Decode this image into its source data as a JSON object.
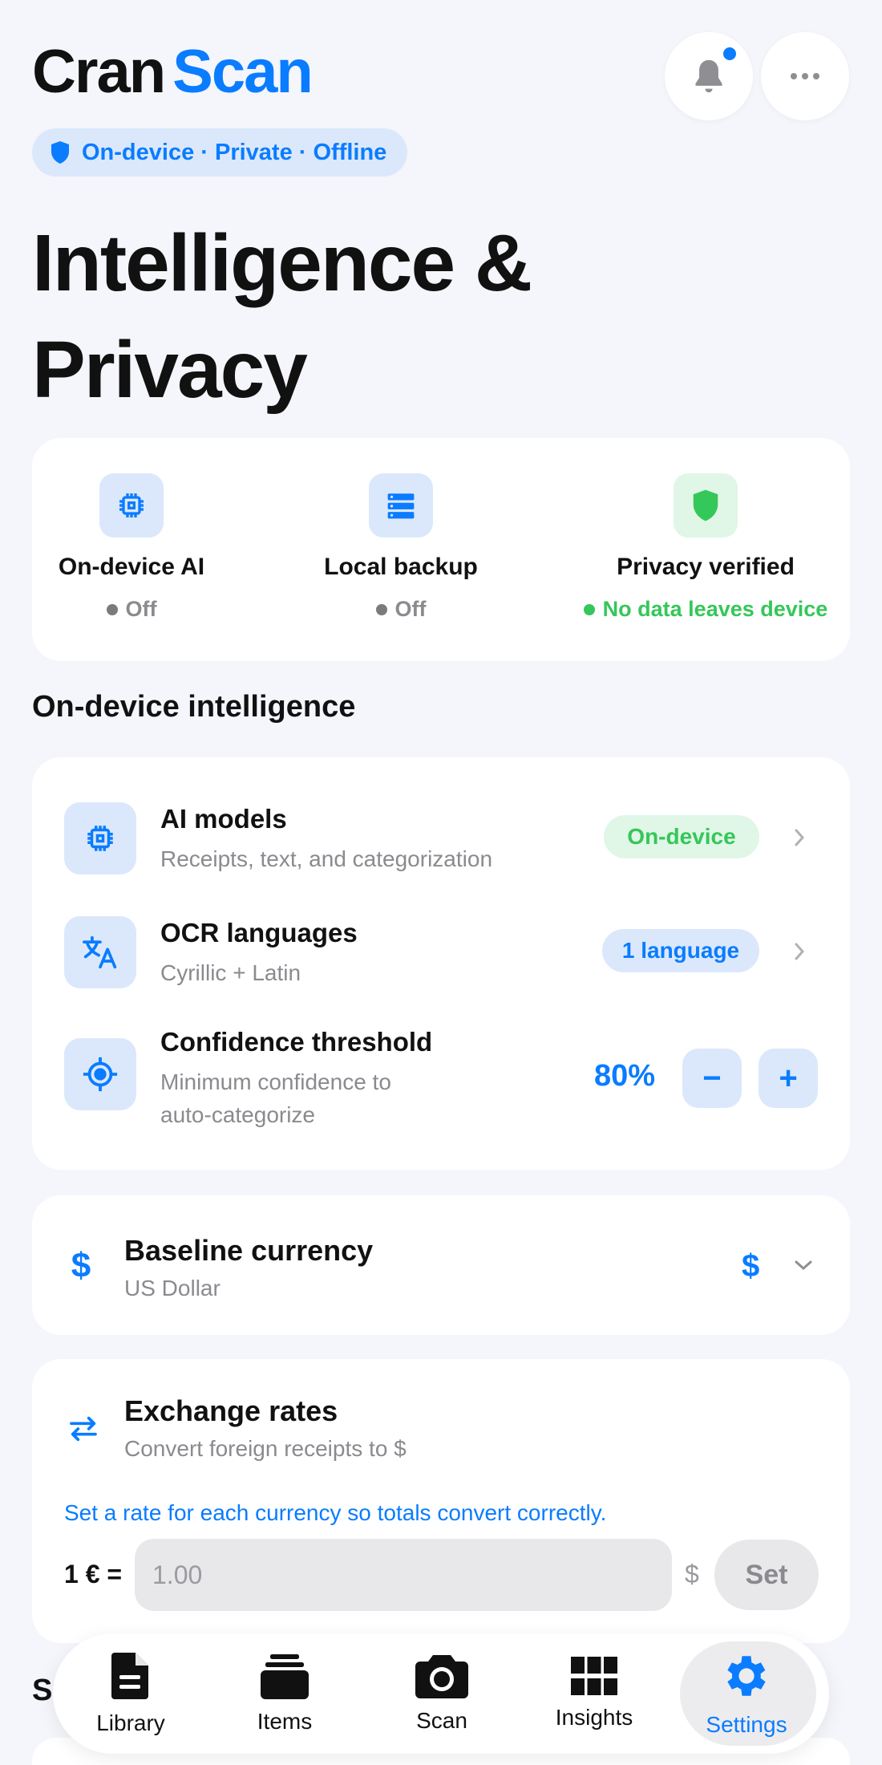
{
  "app": {
    "brand_part1": "Cran",
    "brand_part2": "Scan",
    "privacy_pill": "On-device · Private · Offline"
  },
  "colors": {
    "accent": "#0a7cff",
    "success": "#34c759",
    "background": "#f4f6fb"
  },
  "page": {
    "title": "Intelligence & Privacy"
  },
  "status": [
    {
      "label": "On-device AI",
      "value": "Off",
      "icon": "chip-icon"
    },
    {
      "label": "Local backup",
      "value": "Off",
      "icon": "storage-icon"
    },
    {
      "label": "Privacy verified",
      "value": "No data leaves device",
      "icon": "shield-icon"
    }
  ],
  "intel": {
    "section_title": "On-device intelligence",
    "models": {
      "title": "AI models",
      "subtitle": "Receipts, text, and categorization",
      "badge": "On-device"
    },
    "ocr": {
      "title": "OCR languages",
      "subtitle": "Cyrillic + Latin",
      "badge": "1 language"
    },
    "confidence": {
      "title": "Confidence threshold",
      "subtitle_line1": "Minimum confidence to",
      "subtitle_line2": "auto-categorize",
      "value": "80%",
      "minus": "−",
      "plus": "+"
    }
  },
  "currency": {
    "title": "Baseline currency",
    "subtitle": "US Dollar",
    "symbol": "$"
  },
  "exchange": {
    "title": "Exchange rates",
    "subtitle": "Convert foreign receipts to $",
    "hint": "Set a rate for each currency so totals convert correctly.",
    "rate_label": "1 € =",
    "rate_placeholder": "1.00",
    "currency_symbol": "$",
    "set_label": "Set"
  },
  "next_section_peek": "S",
  "tabs": [
    {
      "label": "Library",
      "icon": "document-icon"
    },
    {
      "label": "Items",
      "icon": "stack-icon"
    },
    {
      "label": "Scan",
      "icon": "camera-icon"
    },
    {
      "label": "Insights",
      "icon": "grid-icon"
    },
    {
      "label": "Settings",
      "icon": "gear-icon",
      "active": true
    }
  ]
}
